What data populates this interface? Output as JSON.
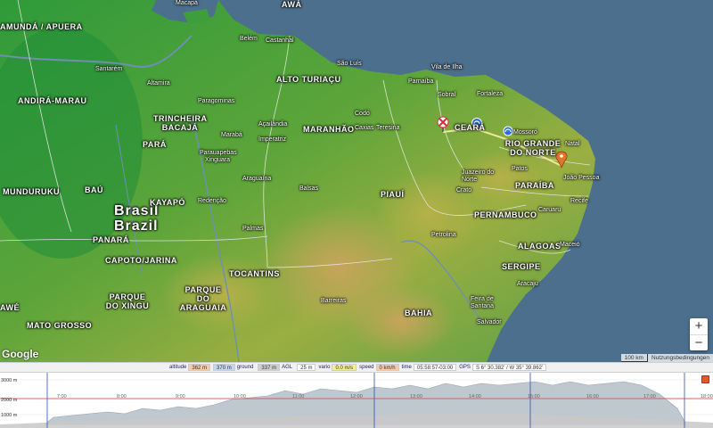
{
  "map": {
    "country_label": [
      "Brasil",
      "Brazil"
    ],
    "state_labels": [
      "AMUNDÁ / APUERA",
      "ANDIRÁ-MARAU",
      "TRINCHEIRA BACAJÁ",
      "ALTO TURIAÇU",
      "MARANHÃO",
      "PARÁ",
      "CEARÁ",
      "RIO GRANDE DO NORTE",
      "PARAÍBA",
      "PERNAMBUCO",
      "PIAUÍ",
      "ALAGOAS",
      "SERGIPE",
      "BAHIA",
      "TOCANTINS",
      "MUNDURUKU",
      "BAÚ",
      "KAYAPÓ",
      "PANARÁ",
      "CAPOTO/JARINA",
      "PARQUE DO XINGU",
      "PARQUE DO ARAGUAIA",
      "MATO GROSSO",
      "AWÁ",
      "AWÉ"
    ],
    "city_labels": [
      "Macapá",
      "Belém",
      "Castanhal",
      "Santarém",
      "Altamira",
      "São Luís",
      "Fortaleza",
      "Sobral",
      "Mossoró",
      "Natal",
      "João Pessoa",
      "Recife",
      "Maceió",
      "Aracaju",
      "Salvador",
      "Teresina",
      "Petrolina",
      "Juazeiro do Norte",
      "Marabá",
      "Imperatriz",
      "Araguaína",
      "Palmas",
      "Barreiras",
      "Feira de Santana",
      "Redenção",
      "Xinguara",
      "Parauapebas",
      "Caxias",
      "Codó",
      "Paragominas",
      "Açailândia",
      "Balsas",
      "Vila de Ilha",
      "Parnaíba",
      "Crato",
      "Caruaru",
      "Patos"
    ],
    "zoom_in": "+",
    "zoom_out": "−",
    "google_logo": "Google",
    "scale": "100 km",
    "terms": "Nutzungsbedingungen"
  },
  "infobar": {
    "altitude_key": "altitude",
    "altitude_val": "362 m",
    "ground_key": "ground",
    "ground_val": "370 m",
    "agl_key": "AGL",
    "agl_val": "337 m",
    "agl2_val": "25 m",
    "vario_key": "vario",
    "vario_val": "0.0 m/s",
    "speed_key": "speed",
    "speed_val": "0 km/h",
    "time_key": "time",
    "time_val": "05:58:57-03:00",
    "gps_key": "GPS",
    "gps_val": "S 6° 30.382' / W 35° 39.862'"
  },
  "graph": {
    "y_ticks": [
      "3000 m",
      "2000 m",
      "1000 m"
    ],
    "x_ticks": [
      "8:00",
      "9:00",
      "10:00",
      "11:00",
      "12:00",
      "13:00",
      "14:00",
      "15:00",
      "16:00",
      "17:00"
    ],
    "left_tick": "7:00",
    "right_tick": "18:00"
  },
  "colors": {
    "ocean": "#4b6f8c",
    "track": "#f0e08a",
    "altitude_fill": "#bfc7cf",
    "ground_fill": "#c8c8c8"
  }
}
